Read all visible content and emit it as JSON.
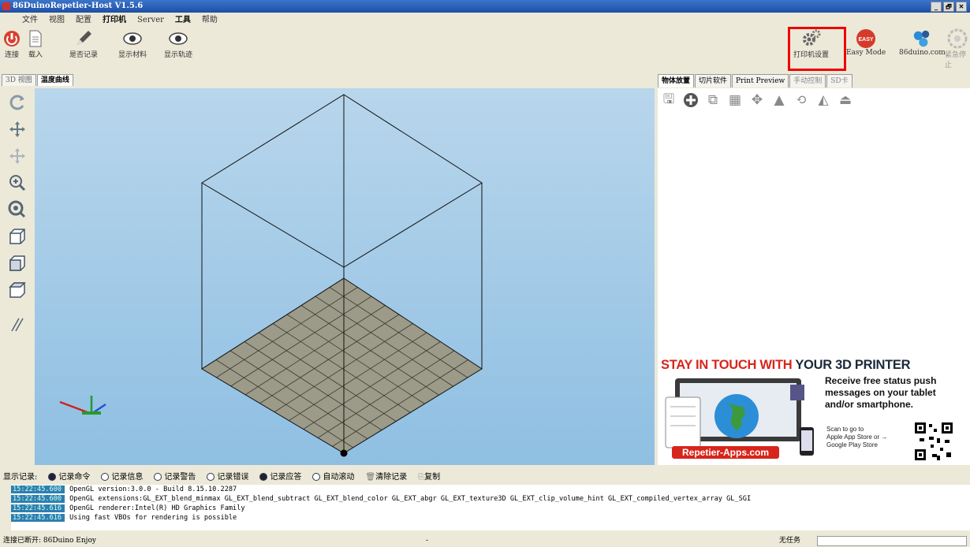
{
  "window": {
    "title": "86DuinoRepetier-Host V1.5.6",
    "controls": [
      "_",
      "🗗",
      "✕"
    ]
  },
  "menu": [
    "文件",
    "视图",
    "配置",
    "打印机",
    "Server",
    "工具",
    "帮助"
  ],
  "toolbar": {
    "connect_label": "连接",
    "load_label": "载入",
    "log_label": "是否记录",
    "show_material_label": "显示材料",
    "show_path_label": "显示轨迹",
    "printer_settings_label": "打印机设置",
    "easy_mode_label": "Easy Mode",
    "easy_badge": "EASY",
    "site_label": "86duino.com",
    "estop_label": "紧急停止"
  },
  "left_tabs": [
    "3D 视图",
    "温度曲线"
  ],
  "right_tabs": [
    "物体放置",
    "切片软件",
    "Print Preview",
    "手动控制",
    "SD卡"
  ],
  "ad": {
    "title_red": "STAY IN TOUCH WITH",
    "title_dark": "YOUR 3D PRINTER",
    "line1": "Receive free status push",
    "line2": "messages on your tablet",
    "line3": "and/or smartphone.",
    "brand": "Repetier-Apps.com",
    "scan1": "Scan to go to",
    "scan2": "Apple App Store or →",
    "scan3": "Google Play Store",
    "colors": {
      "red": "#d8251b",
      "dark": "#1b2a3a"
    }
  },
  "log": {
    "label": "显示记录:",
    "options": [
      "记录命令",
      "记录信息",
      "记录警告",
      "记录错误",
      "记录应答",
      "自动滚动"
    ],
    "clear_label": "清除记录",
    "copy_label": "复制",
    "lines": [
      {
        "ts": "15:22:45.600",
        "msg": "OpenGL version:3.0.0 - Build 8.15.10.2287"
      },
      {
        "ts": "15:22:45.600",
        "msg": "OpenGL extensions:GL_EXT_blend_minmax GL_EXT_blend_subtract GL_EXT_blend_color GL_EXT_abgr GL_EXT_texture3D GL_EXT_clip_volume_hint GL_EXT_compiled_vertex_array GL_SGI"
      },
      {
        "ts": "15:22:45.616",
        "msg": "OpenGL renderer:Intel(R) HD Graphics Family"
      },
      {
        "ts": "15:22:45.616",
        "msg": "Using fast VBOs for rendering is possible"
      }
    ]
  },
  "status": {
    "left": "连接已断开: 86Duino Enjoy",
    "mid": "-",
    "right": "无任务"
  }
}
